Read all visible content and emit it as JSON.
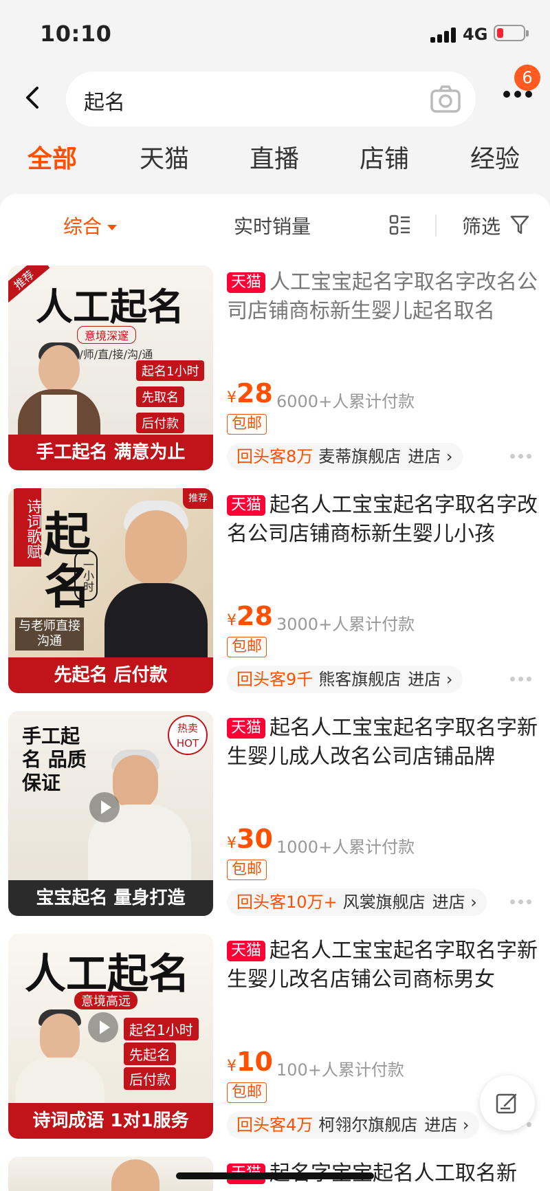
{
  "status_bar": {
    "time": "10:10",
    "network": "4G"
  },
  "search": {
    "query": "起名",
    "cart_badge": "6"
  },
  "tabs": [
    "全部",
    "天猫",
    "直播",
    "店铺",
    "经验"
  ],
  "sort": {
    "comprehensive": "综合",
    "sales": "实时销量",
    "filter": "筛选"
  },
  "colors": {
    "accent": "#ff5000",
    "tmall": "#ff0036"
  },
  "products": [
    {
      "badge": "天猫",
      "title": "人工宝宝起名字取名字改名公司店铺商标新生婴儿起名取名",
      "price_symbol": "¥",
      "price": "28",
      "sold": "6000+人累计付款",
      "shipping": "包邮",
      "returning": "回头客8万",
      "shop": "麦蒂旗舰店",
      "enter": "进店 ›",
      "image": {
        "headline": "人工起名",
        "band": "手工起名 满意为止",
        "corner": "推荐",
        "sub": "意境深邃",
        "sub2": "与/老/师/直/接/沟/通",
        "tags": [
          "起名1小时",
          "先取名",
          "后付款"
        ]
      }
    },
    {
      "badge": "天猫",
      "title": "起名人工宝宝起名字取名字改名公司店铺商标新生婴儿小孩",
      "price_symbol": "¥",
      "price": "28",
      "sold": "3000+人累计付款",
      "shipping": "包邮",
      "returning": "回头客9千",
      "shop": "熊客旗舰店",
      "enter": "进店 ›",
      "image": {
        "headline": "起名",
        "band": "先起名 后付款",
        "corner": "推荐",
        "side": "诗词歌赋",
        "tag": "与老师直接沟通",
        "sub": "一小时"
      }
    },
    {
      "badge": "天猫",
      "title": "起名人工宝宝起名字取名字新生婴儿成人改名公司店铺品牌",
      "price_symbol": "¥",
      "price": "30",
      "sold": "1000+人累计付款",
      "shipping": "包邮",
      "returning": "回头客10万+",
      "shop": "风裳旗舰店",
      "enter": "进店 ›",
      "image": {
        "headline": "手工起名 品质保证",
        "band": "宝宝起名 量身打造",
        "corner": "热卖 HOT"
      }
    },
    {
      "badge": "天猫",
      "title": "起名人工宝宝起名字取名字新生婴儿改名店铺公司商标男女",
      "price_symbol": "¥",
      "price": "10",
      "sold": "100+人累计付款",
      "shipping": "包邮",
      "returning": "回头客4万",
      "shop": "柯翎尔旗舰店",
      "enter": "进店 ›",
      "image": {
        "headline": "人工起名",
        "band": "诗词成语 1对1服务",
        "sub": "意境高远",
        "tags": [
          "起名1小时",
          "先起名",
          "后付款"
        ]
      }
    },
    {
      "badge": "天猫",
      "title": "起名字宝宝起名人工取名新"
    }
  ]
}
